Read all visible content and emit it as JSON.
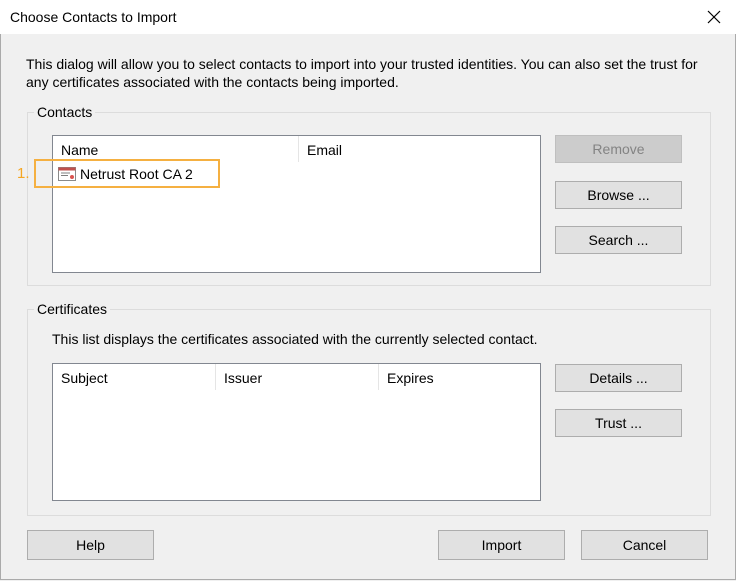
{
  "window": {
    "title": "Choose Contacts to Import",
    "close_glyph": "✕"
  },
  "intro_text": "This dialog will allow you to select contacts to import into your trusted identities. You can also set the trust for any certificates associated with the contacts being imported.",
  "contacts_group": {
    "label": "Contacts",
    "columns": [
      "Name",
      "Email"
    ],
    "rows": [
      {
        "name": "Netrust Root CA 2",
        "email": "",
        "icon": "certificate-icon"
      }
    ],
    "buttons": {
      "remove": "Remove",
      "browse": "Browse ...",
      "search": "Search ..."
    }
  },
  "certificates_group": {
    "label": "Certificates",
    "description": "This list displays the certificates associated with the currently selected contact.",
    "columns": [
      "Subject",
      "Issuer",
      "Expires"
    ],
    "buttons": {
      "details": "Details ...",
      "trust": "Trust ..."
    }
  },
  "footer": {
    "help": "Help",
    "import": "Import",
    "cancel": "Cancel"
  },
  "annotation": {
    "number": "1.",
    "color": "#f5b041"
  }
}
